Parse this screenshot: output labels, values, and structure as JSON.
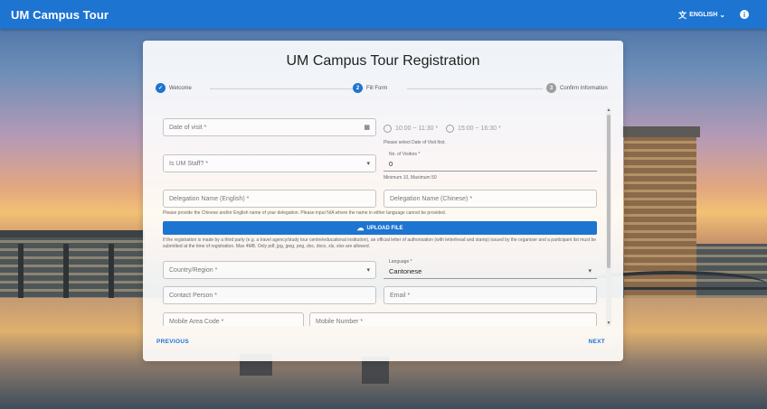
{
  "appbar": {
    "title": "UM Campus Tour",
    "language": "ENGLISH",
    "translate_icon": "translate-icon",
    "info_icon": "info-icon"
  },
  "card": {
    "title": "UM Campus Tour Registration"
  },
  "steps": [
    {
      "label": "Welcome",
      "number": "✓",
      "state": "done"
    },
    {
      "label": "Fill Form",
      "number": "2",
      "state": "active"
    },
    {
      "label": "Confirm Information",
      "number": "3",
      "state": "todo"
    }
  ],
  "form": {
    "date_of_visit": "Date of visit *",
    "slot_1": "10:00 ~ 11:30 *",
    "slot_2": "15:00 ~ 16:30 *",
    "slot_hint": "Please select Date of Visit first.",
    "is_um_staff": "Is UM Staff? *",
    "visitors_label": "No. of Visitors *",
    "visitors_value": "0",
    "visitors_hint": "Minimum 10, Maximum 50",
    "delegation_en": "Delegation Name (English) *",
    "delegation_zh": "Delegation Name (Chinese) *",
    "delegation_hint": "Please provide the Chinese and/or English name of your delegation. Please input N/A where the name in either language cannot be provided.",
    "upload_label": "UPLOAD FILE",
    "upload_hint": "If the registration is made by a third party (e.g. a travel agency/study tour centre/educational institution), an official letter of authorisation (with letterhead and stamp) issued by the organiser and a participant list must be submitted at the time of registration. Max 4MB. Only pdf, jpg, jpeg, png, doc, docx, xls, xlsx are allowed.",
    "country": "Country/Region *",
    "language_label": "Language *",
    "language_value": "Cantonese",
    "contact_person": "Contact Person *",
    "email": "Email *",
    "mobile_area": "Mobile Area Code *",
    "mobile_number": "Mobile Number *"
  },
  "actions": {
    "previous": "PREVIOUS",
    "next": "NEXT"
  }
}
